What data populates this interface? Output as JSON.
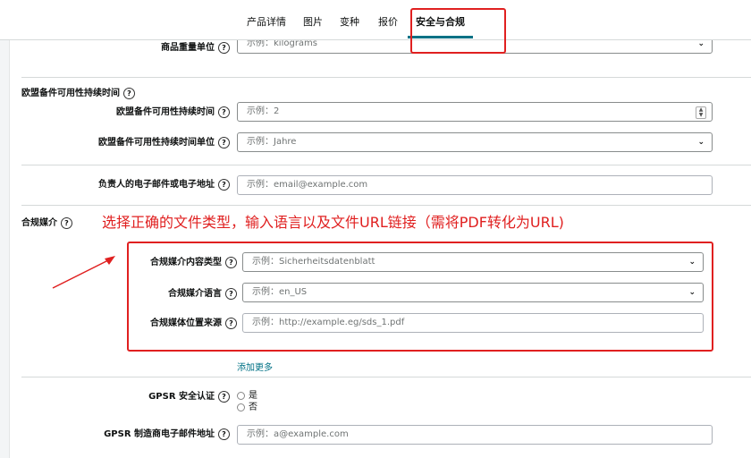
{
  "tabs": [
    {
      "label": "产品详情"
    },
    {
      "label": "图片"
    },
    {
      "label": "变种"
    },
    {
      "label": "报价"
    },
    {
      "label": "安全与合规"
    }
  ],
  "fields": {
    "net_weight_unit": {
      "label": "商品重量单位",
      "placeholder": "示例：kilograms"
    },
    "eu_spare_parts_section": "欧盟备件可用性持续时间",
    "eu_spare_parts_duration": {
      "label": "欧盟备件可用性持续时间",
      "placeholder": "示例：2"
    },
    "eu_spare_parts_unit": {
      "label": "欧盟备件可用性持续时间单位",
      "placeholder": "示例：Jahre"
    },
    "responsible_email": {
      "label": "负责人的电子邮件或电子地址",
      "placeholder": "示例：email@example.com"
    },
    "compliance_media_section": "合规媒介",
    "content_type": {
      "label": "合规媒介内容类型",
      "placeholder": "示例：Sicherheitsdatenblatt"
    },
    "media_language": {
      "label": "合规媒介语言",
      "placeholder": "示例：en_US"
    },
    "media_source": {
      "label": "合规媒体位置来源",
      "placeholder": "示例：http://example.eg/sds_1.pdf"
    },
    "add_more": "添加更多",
    "gpsr_cert": {
      "label": "GPSR 安全认证",
      "options": [
        "是",
        "否"
      ]
    },
    "gpsr_email": {
      "label": "GPSR 制造商电子邮件地址",
      "placeholder": "示例：a@example.com"
    }
  },
  "annotation": "选择正确的文件类型，输入语言以及文件URL链接（需将PDF转化为URL)",
  "colors": {
    "annotation": "#e02020",
    "link": "#007185",
    "active_tab_underline": "#007185"
  }
}
